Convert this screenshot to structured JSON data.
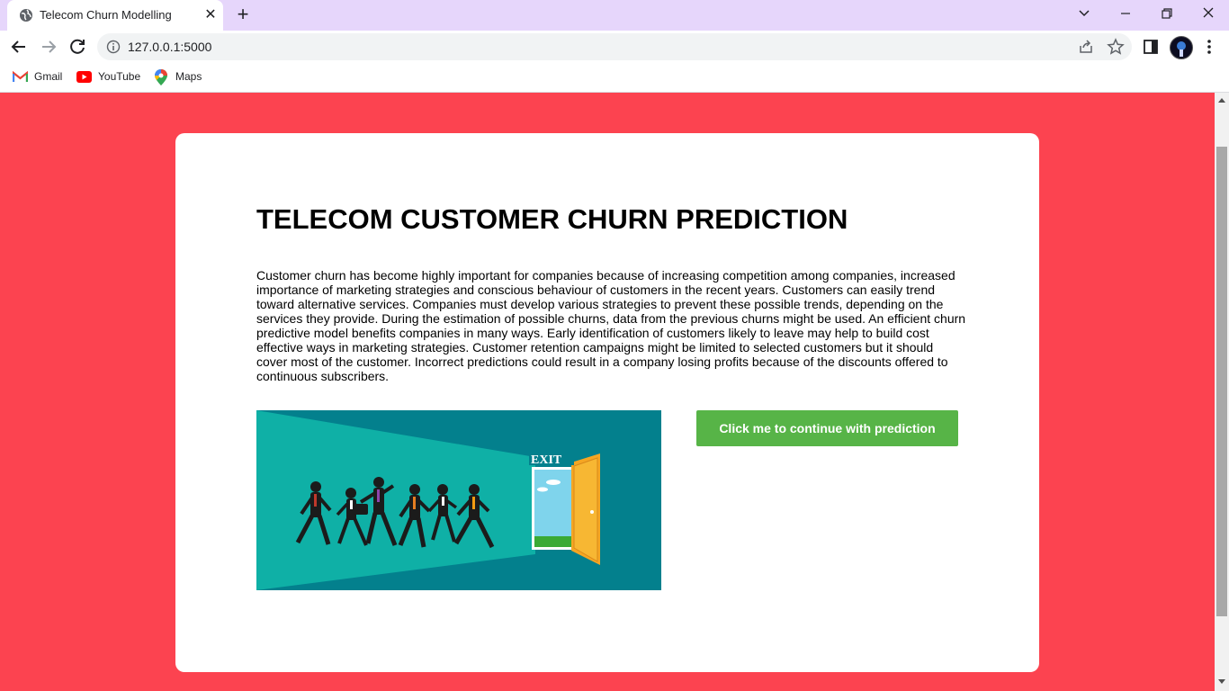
{
  "browser": {
    "tab_title": "Telecom Churn Modelling",
    "url": "127.0.0.1:5000",
    "bookmarks": [
      {
        "label": "Gmail",
        "icon": "gmail-icon"
      },
      {
        "label": "YouTube",
        "icon": "youtube-icon"
      },
      {
        "label": "Maps",
        "icon": "maps-icon"
      }
    ]
  },
  "page": {
    "background_color": "#fc4350",
    "heading": "TELECOM CUSTOMER CHURN PREDICTION",
    "description": "Customer churn has become highly important for companies because of increasing competition among companies, increased importance of marketing strategies and conscious behaviour of customers in the recent years. Customers can easily trend toward alternative services. Companies must develop various strategies to prevent these possible trends, depending on the services they provide. During the estimation of possible churns, data from the previous churns might be used. An efficient churn predictive model benefits companies in many ways. Early identification of customers likely to leave may help to build cost effective ways in marketing strategies. Customer retention campaigns might be limited to selected customers but it should cover most of the customer. Incorrect predictions could result in a company losing profits because of the discounts offered to continuous subscribers.",
    "illustration_sign": "EXIT",
    "cta_label": "Click me to continue with prediction",
    "cta_color": "#57b447"
  }
}
